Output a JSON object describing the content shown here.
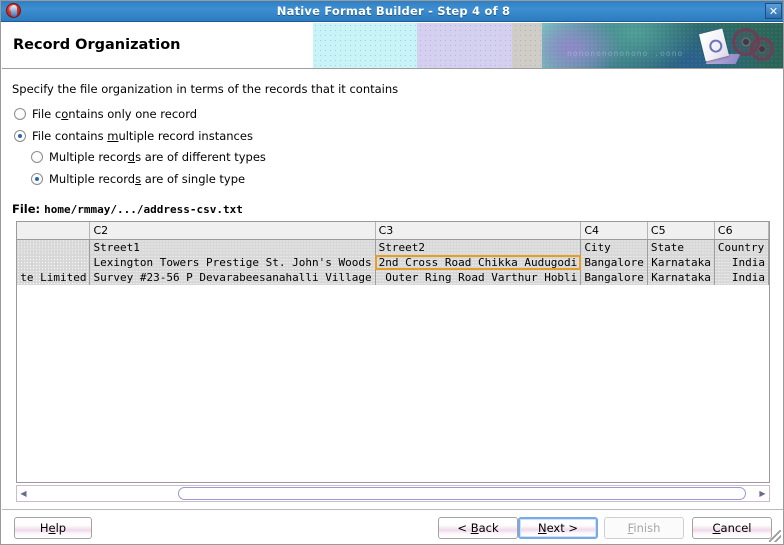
{
  "window": {
    "title": "Native Format Builder - Step 4 of 8",
    "app_icon": "oracle-orb-icon",
    "close_icon": "close-icon"
  },
  "banner": {
    "heading": "Record Organization",
    "art_text": "nonononononono .oono"
  },
  "content": {
    "instruction": "Specify the file organization in terms of the records that it contains",
    "options": [
      {
        "label_before": "File c",
        "mnemonic": "o",
        "label_after": "ntains only one record",
        "checked": false,
        "indent": "top"
      },
      {
        "label_before": "File contains ",
        "mnemonic": "m",
        "label_after": "ultiple record instances",
        "checked": true,
        "indent": "top"
      },
      {
        "label_before": "Multiple recor",
        "mnemonic": "d",
        "label_after": "s are of different types",
        "checked": false,
        "indent": "sub"
      },
      {
        "label_before": "Multiple record",
        "mnemonic": "s",
        "label_after": " are of single type",
        "checked": true,
        "indent": "sub"
      }
    ],
    "file_label": "File: ",
    "file_path": "home/rmmay/.../address-csv.txt"
  },
  "table": {
    "columns": [
      "",
      "C2",
      "C3",
      "C4",
      "C5",
      "C6"
    ],
    "rows": [
      {
        "cells": [
          "",
          "Street1",
          "Street2",
          "City",
          "State",
          "Country"
        ],
        "selected_index": -1
      },
      {
        "cells": [
          "",
          "Lexington Towers Prestige St. John's Woods",
          "2nd Cross Road Chikka Audugodi",
          "Bangalore",
          "Karnataka",
          "India"
        ],
        "selected_index": 2
      },
      {
        "cells": [
          "te Limited",
          "Survey #23-56 P Devarabeesanahalli Village",
          "Outer Ring Road Varthur Hobli",
          "Bangalore",
          "Karnataka",
          "India"
        ],
        "selected_index": -1
      }
    ]
  },
  "scrollbar": {
    "left_arrow": "◀",
    "right_arrow": "▶"
  },
  "footer": {
    "help": {
      "before": "H",
      "mnemonic": "e",
      "after": "lp"
    },
    "back": {
      "before": "< ",
      "mnemonic": "B",
      "after": "ack"
    },
    "next": {
      "before": "",
      "mnemonic": "N",
      "after": "ext >"
    },
    "finish": {
      "before": "",
      "mnemonic": "F",
      "after": "inish"
    },
    "cancel": {
      "before": "",
      "mnemonic": "C",
      "after": "ancel"
    }
  },
  "colors": {
    "titlebar": "#3d8fd1",
    "selection_outline": "#e59f28",
    "radio_dot": "#2b66b5",
    "band_cyan": "#c9f4f7",
    "band_lavender": "#d5cff0",
    "band_gray": "#cfcdc5",
    "band_teal": "#a7dcd3"
  }
}
